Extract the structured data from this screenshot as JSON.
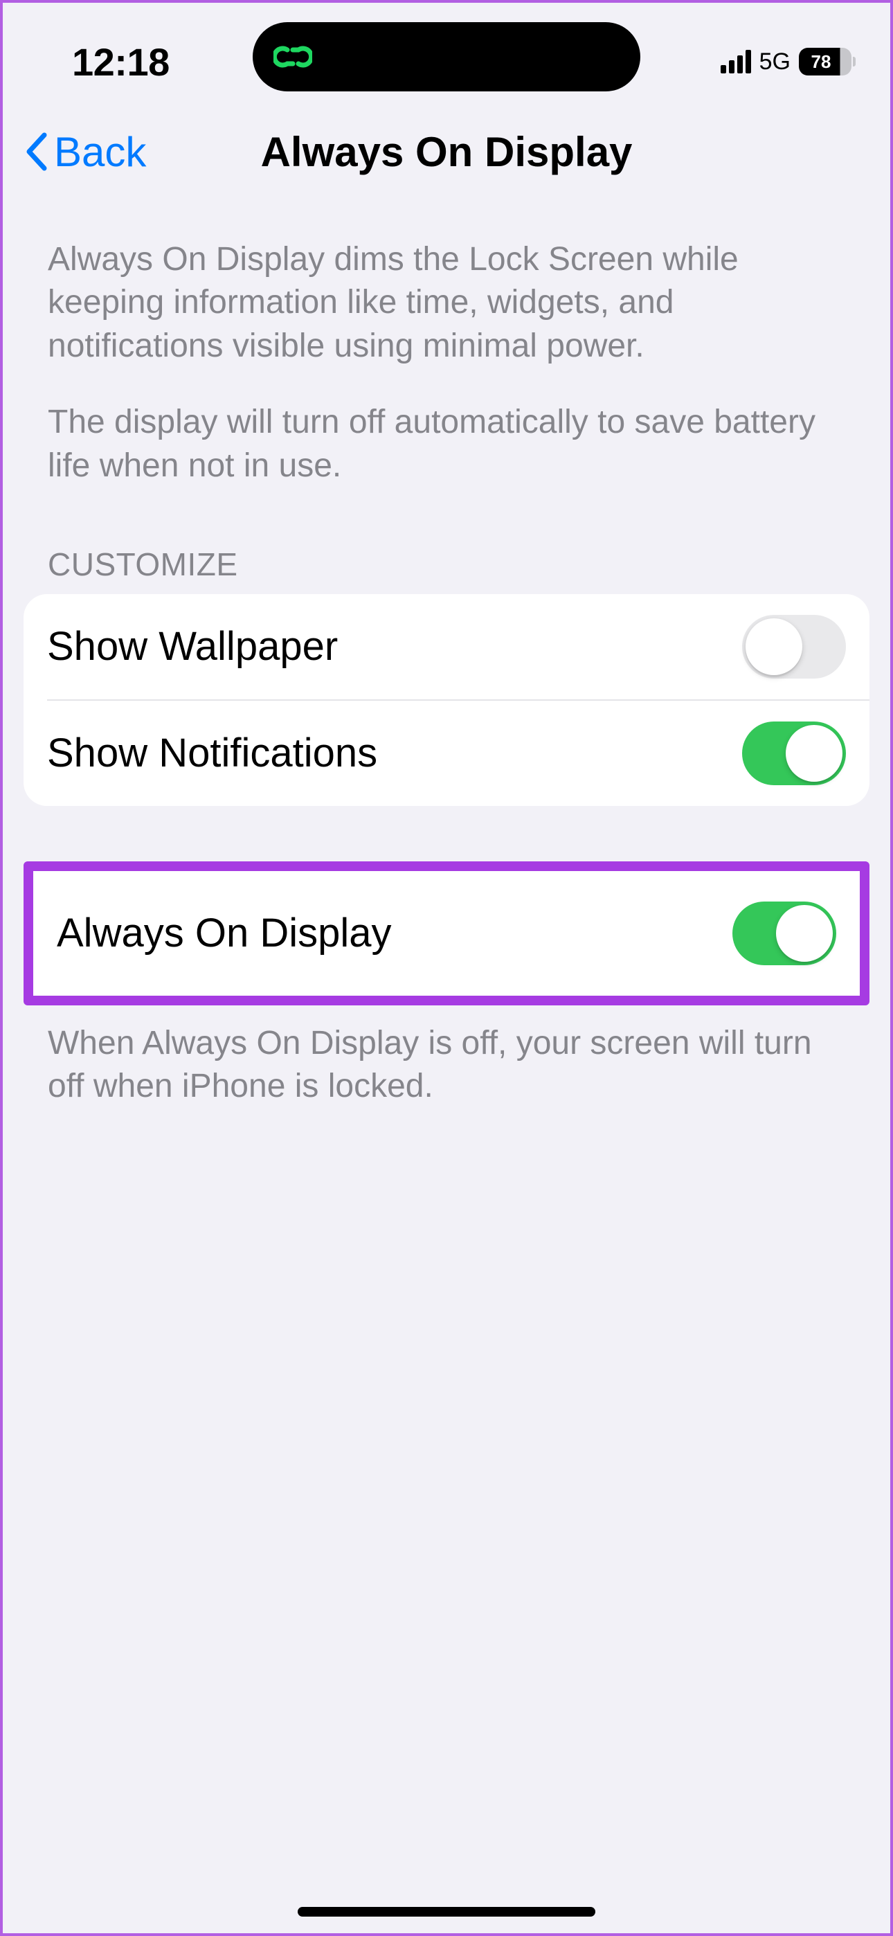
{
  "statusBar": {
    "time": "12:18",
    "network": "5G",
    "batteryPct": "78"
  },
  "nav": {
    "backLabel": "Back",
    "title": "Always On Display"
  },
  "description": {
    "p1": "Always On Display dims the Lock Screen while keeping information like time, widgets, and notifications visible using minimal power.",
    "p2": "The display will turn off automatically to save battery life when not in use."
  },
  "sections": {
    "customizeHeader": "CUSTOMIZE",
    "rows": {
      "showWallpaper": {
        "label": "Show Wallpaper",
        "on": false
      },
      "showNotifications": {
        "label": "Show Notifications",
        "on": true
      },
      "alwaysOn": {
        "label": "Always On Display",
        "on": true
      }
    },
    "footer": "When Always On Display is off, your screen will turn off when iPhone is locked."
  }
}
